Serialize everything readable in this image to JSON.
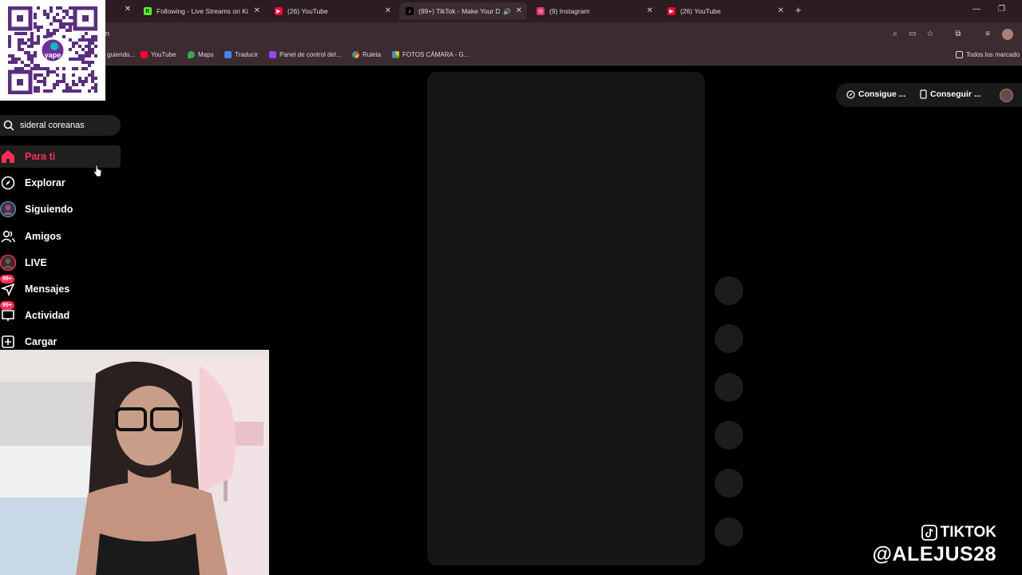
{
  "browser": {
    "tabs": [
      {
        "label": "Following - Live Streams on Ki",
        "icon": "kick-icon",
        "color": "#53fc18"
      },
      {
        "label": "(26) YouTube",
        "icon": "youtube-icon",
        "color": "#ff0033"
      },
      {
        "label": "(99+) TikTok - Make Your Da",
        "icon": "tiktok-icon",
        "color": "#000000",
        "active": true
      },
      {
        "label": "(9) Instagram",
        "icon": "instagram-icon",
        "color": "#e1306c"
      },
      {
        "label": "(26) YouTube",
        "icon": "youtube-icon",
        "color": "#ff0033"
      }
    ],
    "address_fragment": "n",
    "bookmarks": [
      {
        "label": "guiendo...",
        "icon": "bookmark-icon"
      },
      {
        "label": "YouTube",
        "icon": "youtube-icon"
      },
      {
        "label": "Maps",
        "icon": "maps-icon"
      },
      {
        "label": "Traducir",
        "icon": "translate-icon"
      },
      {
        "label": "Panel de control del...",
        "icon": "twitch-icon"
      },
      {
        "label": "Ruleta",
        "icon": "google-icon"
      },
      {
        "label": "FOTOS CÁMARA - G...",
        "icon": "drive-icon"
      }
    ],
    "all_bookmarks_label": "Todos los marcado"
  },
  "qr": {
    "brand": "yape"
  },
  "search": {
    "value": "sideral coreanas"
  },
  "nav": {
    "items": [
      {
        "label": "Para ti",
        "icon": "home-icon",
        "active": true
      },
      {
        "label": "Explorar",
        "icon": "compass-icon"
      },
      {
        "label": "Siguiendo",
        "icon": "avatar-icon"
      },
      {
        "label": "Amigos",
        "icon": "friends-icon"
      },
      {
        "label": "LIVE",
        "icon": "live-avatar-icon"
      },
      {
        "label": "Mensajes",
        "icon": "messages-icon",
        "badge": "99+"
      },
      {
        "label": "Actividad",
        "icon": "activity-icon",
        "badge": "99+"
      },
      {
        "label": "Cargar",
        "icon": "upload-icon"
      }
    ]
  },
  "header_actions": {
    "coins_label": "Consigue ...",
    "app_label": "Conseguir ..."
  },
  "watermark": {
    "line1": "TIKTOK",
    "line2": "@ALEJUS28"
  },
  "colors": {
    "accent": "#fe2c55",
    "chrome": "#3c2b31"
  }
}
